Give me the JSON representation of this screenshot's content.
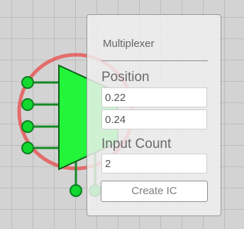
{
  "panel": {
    "title": "Multiplexer",
    "position_label": "Position",
    "position_x": "0.22",
    "position_y": "0.24",
    "input_count_label": "Input Count",
    "input_count": "2",
    "create_button_label": "Create IC"
  },
  "component": {
    "type": "multiplexer",
    "input_pins": 4,
    "select_pins": 2,
    "body_color": "#22f53a",
    "pin_color": "#12d82f",
    "selection_ring_color": "#ea4a4a"
  },
  "colors": {
    "canvas_background": "#d3d3d3",
    "grid_line": "#bcbcbc"
  }
}
